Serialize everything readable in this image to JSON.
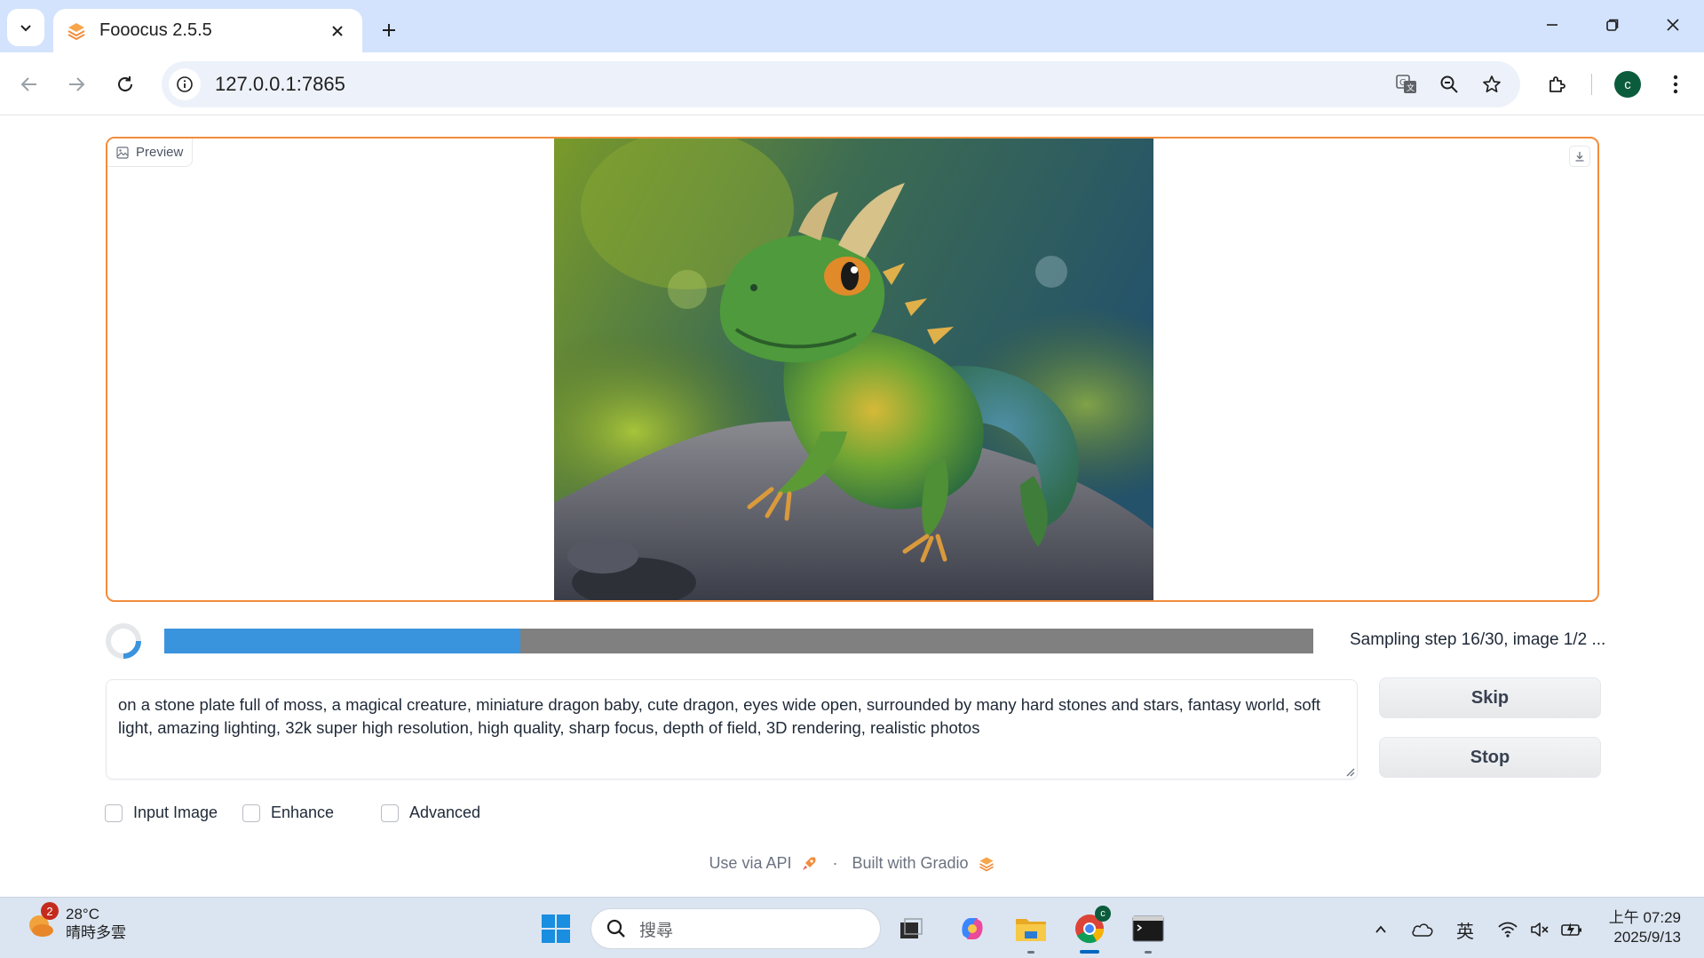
{
  "browser": {
    "tab_title": "Fooocus 2.5.5",
    "url": "127.0.0.1:7865",
    "profile_initial": "c"
  },
  "preview": {
    "label": "Preview",
    "image_alt": "green baby dragon on a mossy stone"
  },
  "progress": {
    "fraction": 0.31,
    "text": "Sampling step 16/30, image 1/2 ..."
  },
  "prompt": {
    "value": "on a stone plate full of moss, a magical creature, miniature dragon baby, cute dragon, eyes wide open, surrounded by many hard stones and stars, fantasy world, soft light, amazing lighting, 32k super high resolution, high quality, sharp focus, depth of field, 3D rendering, realistic photos"
  },
  "buttons": {
    "skip": "Skip",
    "stop": "Stop"
  },
  "options": {
    "input_image": "Input Image",
    "enhance": "Enhance",
    "advanced": "Advanced"
  },
  "footer": {
    "api": "Use via API",
    "separator": "·",
    "built": "Built with Gradio"
  },
  "taskbar": {
    "weather_badge": "2",
    "temperature": "28°C",
    "condition": "晴時多雲",
    "search_placeholder": "搜尋",
    "chrome_badge": "c",
    "ime": "英",
    "time": "上午 07:29",
    "date": "2025/9/13"
  },
  "colors": {
    "accent_orange": "#f28c3c",
    "progress_blue": "#3a93dd",
    "progress_track": "#808080",
    "tabstrip": "#d3e3fd"
  }
}
